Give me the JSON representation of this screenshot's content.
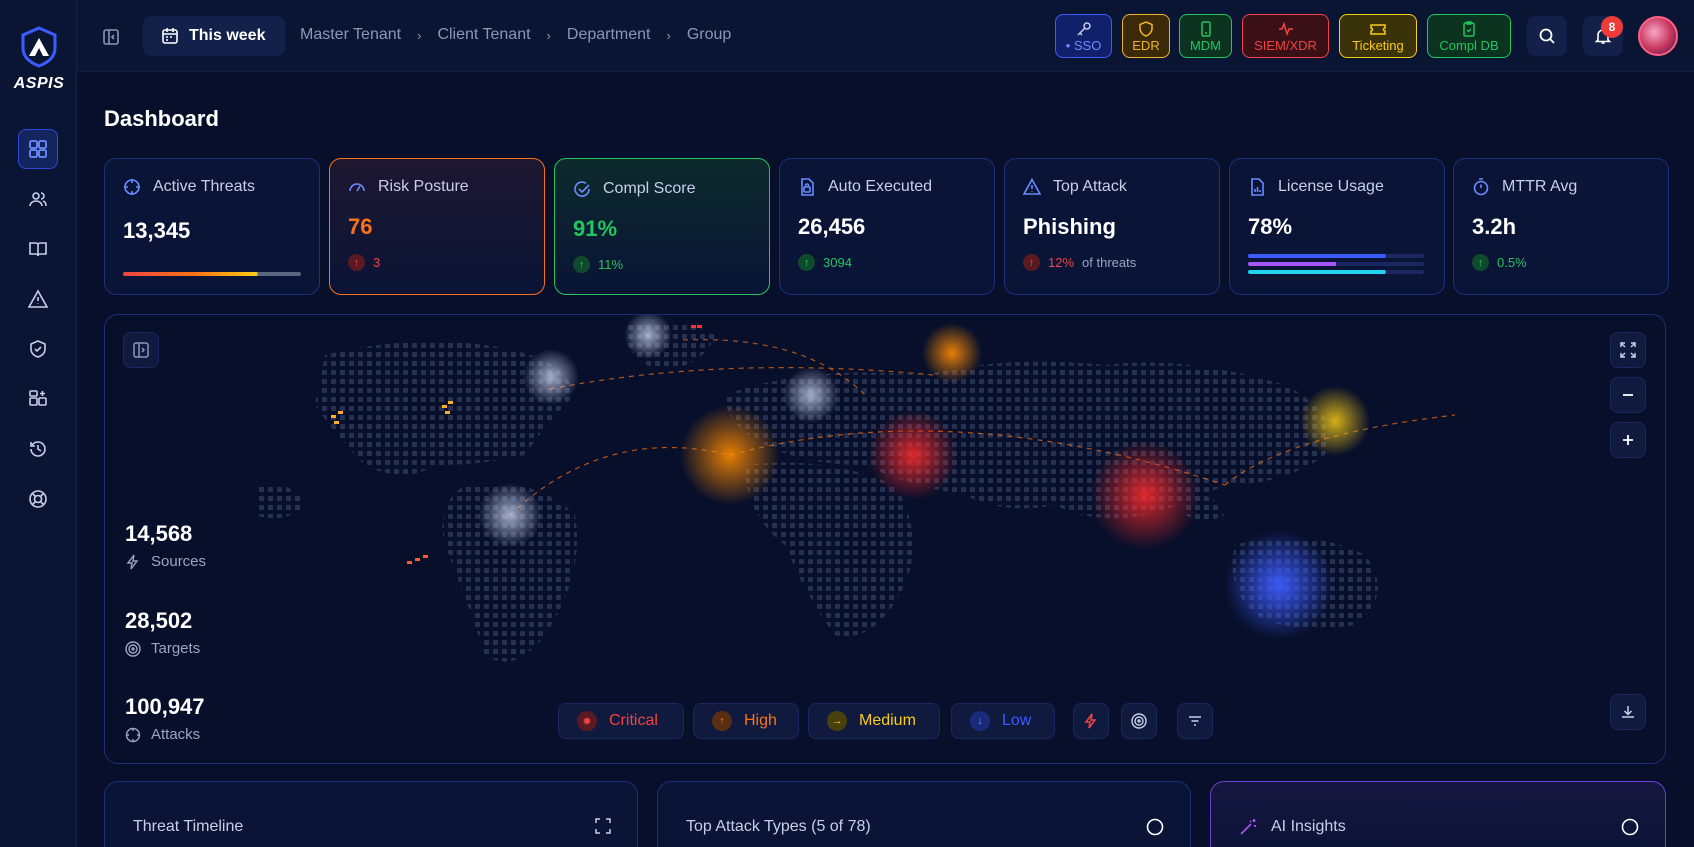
{
  "app": {
    "logo_text": "ASPIS"
  },
  "topbar": {
    "date_range": "This week",
    "breadcrumb": [
      "Master Tenant",
      "Client Tenant",
      "Department",
      "Group"
    ],
    "integrations": [
      {
        "label": "• SSO",
        "color": "#3d5cff"
      },
      {
        "label": "EDR",
        "color": "#f0b429"
      },
      {
        "label": "MDM",
        "color": "#22c55e"
      },
      {
        "label": "SIEM/XDR",
        "color": "#ef4444"
      },
      {
        "label": "Ticketing",
        "color": "#facc15"
      },
      {
        "label": "Compl DB",
        "color": "#22c55e"
      }
    ],
    "notifications_count": "8"
  },
  "page": {
    "title": "Dashboard"
  },
  "kpis": [
    {
      "label": "Active Threats",
      "value": "13,345",
      "icon": "crosshair-icon"
    },
    {
      "label": "Risk Posture",
      "value": "76",
      "delta": "3",
      "trend": "up-bad",
      "icon": "gauge-icon",
      "accent": "#f97316"
    },
    {
      "label": "Compl Score",
      "value": "91%",
      "delta": "11%",
      "trend": "up-good",
      "icon": "check-circle-icon",
      "accent": "#22c55e"
    },
    {
      "label": "Auto Executed",
      "value": "26,456",
      "delta": "3094",
      "trend": "up-good",
      "icon": "file-lock-icon"
    },
    {
      "label": "Top Attack",
      "value": "Phishing",
      "delta": "12%",
      "delta_suffix": "of threats",
      "trend": "up-bad",
      "icon": "warning-icon"
    },
    {
      "label": "License Usage",
      "value": "78%",
      "icon": "document-chart-icon"
    },
    {
      "label": "MTTR Avg",
      "value": "3.2h",
      "delta": "0.5%",
      "trend": "up-good",
      "icon": "stopwatch-icon"
    }
  ],
  "map": {
    "stats": [
      {
        "value": "14,568",
        "label": "Sources",
        "icon": "bolt-icon"
      },
      {
        "value": "28,502",
        "label": "Targets",
        "icon": "target-icon"
      },
      {
        "value": "100,947",
        "label": "Attacks",
        "icon": "crosshair-icon"
      }
    ],
    "legend": [
      {
        "label": "Critical",
        "color": "#ef4444"
      },
      {
        "label": "High",
        "color": "#f97316"
      },
      {
        "label": "Medium",
        "color": "#facc15"
      },
      {
        "label": "Low",
        "color": "#3d5cff"
      }
    ]
  },
  "panels": [
    {
      "title": "Threat Timeline"
    },
    {
      "title": "Top Attack Types (5 of 78)"
    },
    {
      "title": "AI Insights"
    }
  ]
}
